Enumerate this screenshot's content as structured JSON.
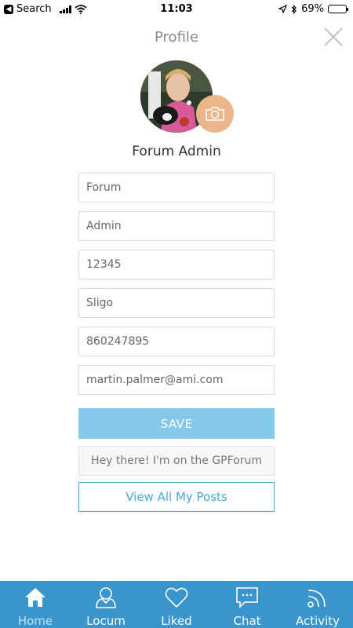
{
  "status_bar": {
    "back_label": "Search",
    "time": "11:03",
    "battery": "69%",
    "battery_level": 0.69
  },
  "header": {
    "title": "Profile"
  },
  "profile": {
    "name": "Forum Admin"
  },
  "fields": [
    {
      "value": "Forum"
    },
    {
      "value": "Admin"
    },
    {
      "value": "12345"
    },
    {
      "value": "Sligo"
    },
    {
      "value": "860247895"
    },
    {
      "value": "martin.palmer@ami.com"
    }
  ],
  "save_label": "SAVE",
  "status_message": {
    "placeholder": "Hey there! I'm on the GPForum"
  },
  "view_posts_label": "View All My Posts",
  "tabs": [
    {
      "label": "Home",
      "icon": "home-icon",
      "active": true
    },
    {
      "label": "Locum",
      "icon": "person-icon"
    },
    {
      "label": "Liked",
      "icon": "heart-icon"
    },
    {
      "label": "Chat",
      "icon": "chat-bubble-icon"
    },
    {
      "label": "Activity",
      "icon": "rss-icon"
    }
  ],
  "colors": {
    "accent": "#3a95cc",
    "save_button": "#86c8ea",
    "camera_button": "#ebb68a"
  }
}
